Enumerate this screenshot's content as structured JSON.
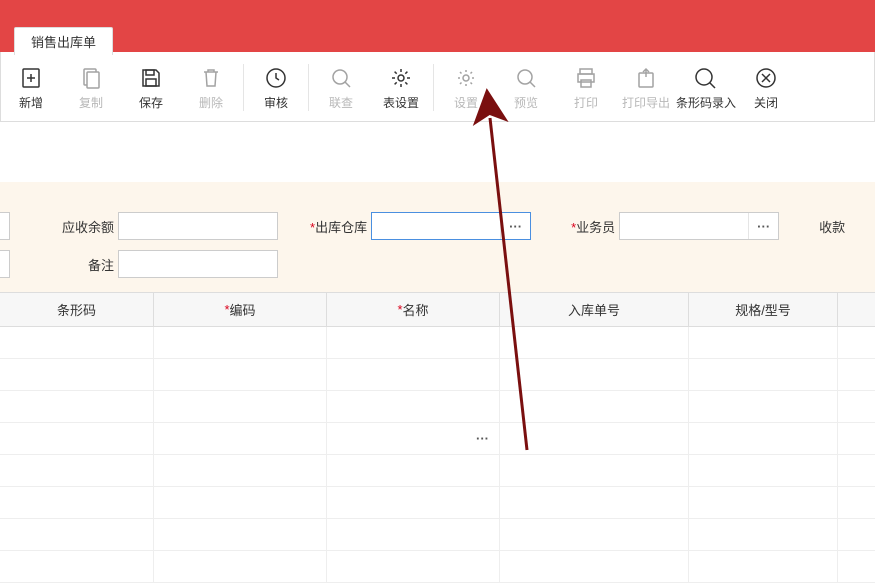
{
  "tab": {
    "label": "销售出库单"
  },
  "toolbar": {
    "new": "新增",
    "copy": "复制",
    "save": "保存",
    "delete": "删除",
    "audit": "审核",
    "joint": "联查",
    "tableset": "表设置",
    "set": "设置",
    "preview": "预览",
    "print": "打印",
    "printexp": "打印导出",
    "barcode": "条形码录入",
    "close": "关闭"
  },
  "form": {
    "receivable_label": "应收余额",
    "receivable_value": "",
    "warehouse_label": "出库仓库",
    "warehouse_value": "",
    "salesperson_label": "业务员",
    "salesperson_value": "",
    "payment_label": "收款",
    "remark_label": "备注",
    "remark_value": ""
  },
  "grid": {
    "headers": {
      "barcode": "条形码",
      "code": "编码",
      "name": "名称",
      "inbound_no": "入库单号",
      "spec": "规格/型号"
    }
  }
}
